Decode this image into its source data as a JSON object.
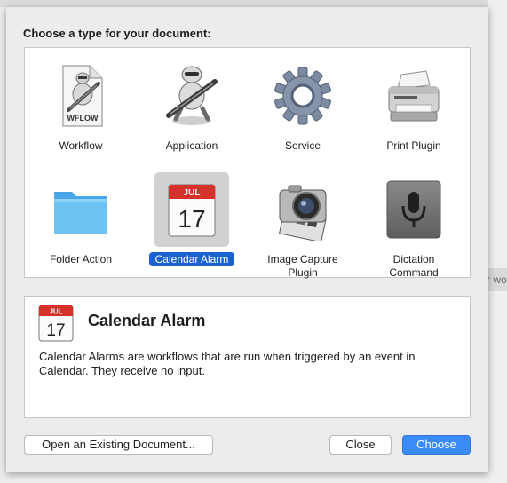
{
  "background_peek_text": "r wo",
  "dialog": {
    "title": "Choose a type for your document:",
    "types": [
      {
        "label": "Workflow",
        "icon": "wflow-document-icon",
        "badge": "WFLOW"
      },
      {
        "label": "Application",
        "icon": "automator-robot-icon"
      },
      {
        "label": "Service",
        "icon": "gear-icon"
      },
      {
        "label": "Print Plugin",
        "icon": "printer-icon"
      },
      {
        "label": "Folder Action",
        "icon": "folder-icon"
      },
      {
        "label": "Calendar Alarm",
        "icon": "calendar-icon",
        "month": "JUL",
        "day": "17",
        "selected": true
      },
      {
        "label": "Image Capture Plugin",
        "line1": "Image Capture",
        "line2": "Plugin",
        "icon": "camera-icon"
      },
      {
        "label": "Dictation Command",
        "line1": "Dictation",
        "line2": "Command",
        "icon": "microphone-icon"
      }
    ],
    "description": {
      "title": "Calendar Alarm",
      "text": "Calendar Alarms are workflows that are run when triggered by an event in Calendar. They receive no input.",
      "month": "JUL",
      "day": "17"
    },
    "buttons": {
      "open_existing": "Open an Existing Document...",
      "close": "Close",
      "choose": "Choose"
    }
  },
  "colors": {
    "accent": "#3b8bf6",
    "selection": "#1a63cf",
    "calendar_red": "#d7312b",
    "folder_blue": "#5fb8f2"
  }
}
